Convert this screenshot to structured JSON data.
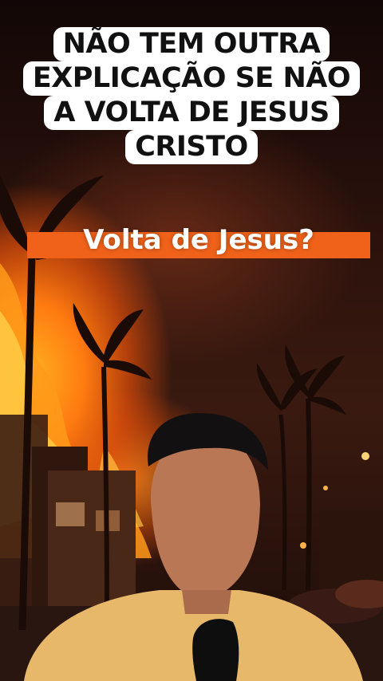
{
  "caption": {
    "lines": [
      "NÃO TEM OUTRA",
      "EXPLICAÇÃO SE NÃO",
      "A VOLTA DE JESUS",
      "CRISTO"
    ]
  },
  "banner": {
    "text": "Volta de Jesus?",
    "color": "#f0621a"
  },
  "colors": {
    "caption_bg": "#ffffff",
    "caption_text": "#111111",
    "fire": "#ff8a1c"
  }
}
